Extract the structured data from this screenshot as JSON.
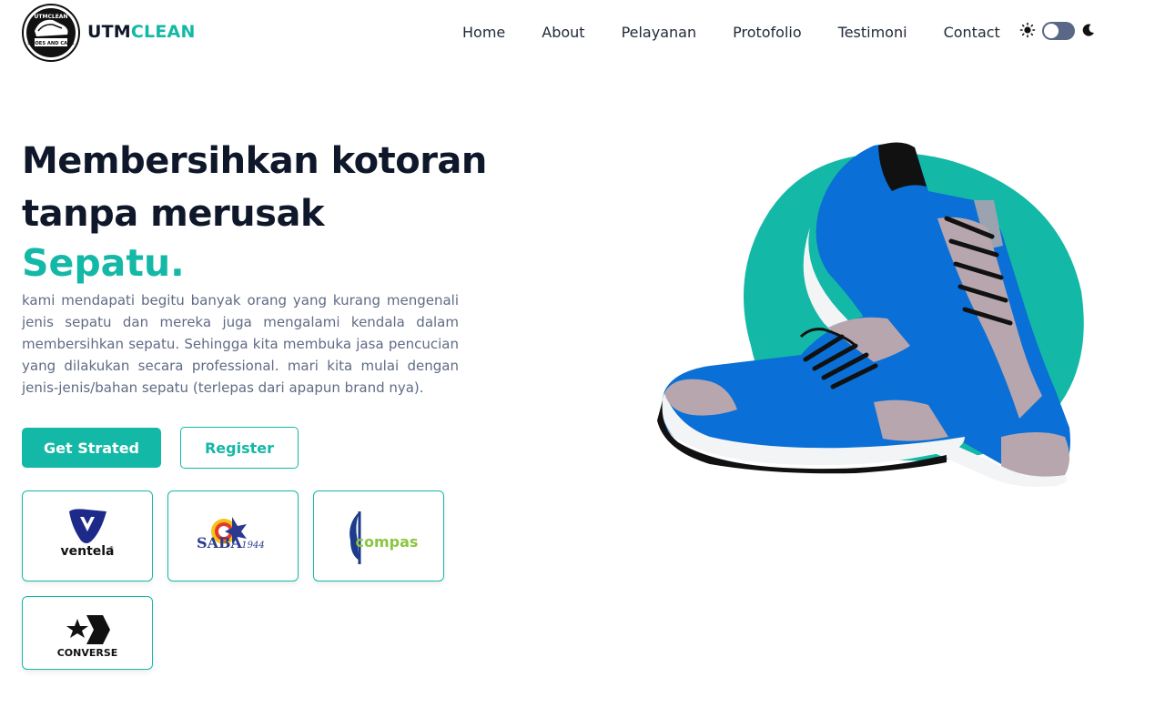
{
  "brand": {
    "name_part1": "UTM",
    "name_part2": "CLEAN"
  },
  "logo": {
    "text_top": "UTMCLEAN",
    "text_bottom": "SHOES AND CARE"
  },
  "nav": {
    "items": [
      {
        "label": "Home"
      },
      {
        "label": "About"
      },
      {
        "label": "Pelayanan"
      },
      {
        "label": "Protofolio"
      },
      {
        "label": "Testimoni"
      },
      {
        "label": "Contact"
      }
    ]
  },
  "theme_toggle": {
    "state": "light",
    "icons": [
      "sun-icon",
      "moon-icon"
    ]
  },
  "hero": {
    "title_line1": "Membersihkan kotoran",
    "title_line2": "tanpa merusak",
    "accent": "Sepatu.",
    "description": "kami mendapati begitu banyak orang yang kurang mengenali jenis sepatu dan mereka juga mengalami kendala dalam membersihkan sepatu. Sehingga kita membuka jasa pencucian yang dilakukan secara professional. mari kita mulai dengan jenis-jenis/bahan sepatu (terlepas dari apapun brand nya).",
    "primary_button": "Get Strated",
    "secondary_button": "Register"
  },
  "brands": [
    {
      "name": "ventela"
    },
    {
      "name": "SABA",
      "suffix": "1944"
    },
    {
      "name": "compas"
    },
    {
      "name": "CONVERSE"
    }
  ],
  "colors": {
    "accent": "#14b8a6",
    "heading": "#0f172a",
    "body_text": "#5f6b85",
    "shoe_blue": "#0a6fd6",
    "toggle_track": "#5a6787"
  }
}
